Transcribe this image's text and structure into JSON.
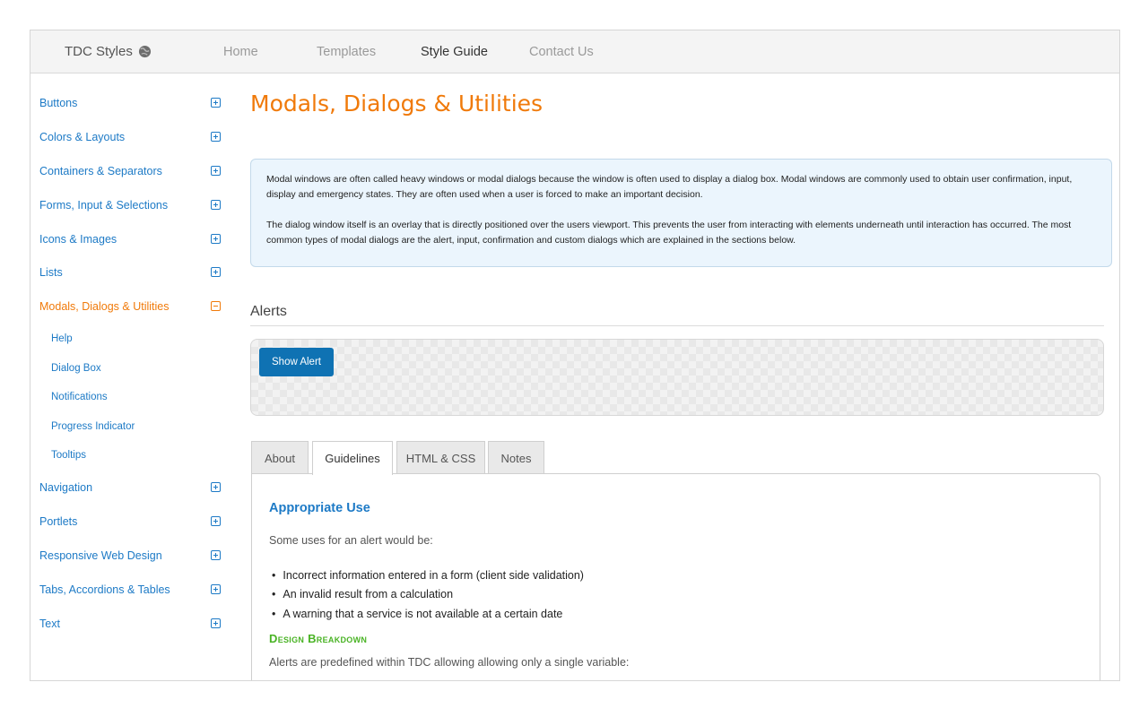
{
  "topnav": {
    "brand": "TDC Styles",
    "items": [
      {
        "label": "Home",
        "active": false
      },
      {
        "label": "Templates",
        "active": false
      },
      {
        "label": "Style Guide",
        "active": true
      },
      {
        "label": "Contact Us",
        "active": false
      }
    ]
  },
  "sidebar": {
    "items": [
      {
        "label": "Buttons"
      },
      {
        "label": "Colors & Layouts"
      },
      {
        "label": "Containers & Separators"
      },
      {
        "label": "Forms, Input & Selections"
      },
      {
        "label": "Icons & Images"
      },
      {
        "label": "Lists"
      },
      {
        "label": "Modals, Dialogs & Utilities"
      },
      {
        "label": "Navigation"
      },
      {
        "label": "Portlets"
      },
      {
        "label": "Responsive Web Design"
      },
      {
        "label": "Tabs, Accordions & Tables"
      },
      {
        "label": "Text"
      }
    ],
    "subitems": [
      "Help",
      "Dialog Box",
      "Notifications",
      "Progress Indicator",
      "Tooltips"
    ]
  },
  "main": {
    "title": "Modals, Dialogs & Utilities",
    "intro": [
      "Modal windows are often called heavy windows or modal dialogs because the window is often used to display a dialog box. Modal windows are commonly used to obtain user confirmation, input, display and emergency states. They are often used when a user is forced to make an important decision.",
      "The dialog window itself is an overlay that is directly positioned over the users viewport. This prevents the user from interacting with elements underneath until interaction has occurred. The most common types of modal dialogs are the alert, input, confirmation and custom dialogs which are explained in the sections below."
    ],
    "section": "Alerts",
    "demo_button": "Show Alert",
    "tabs": [
      "About",
      "Guidelines",
      "HTML & CSS",
      "Notes"
    ],
    "active_tab": "Guidelines",
    "panel": {
      "heading": "Appropriate Use",
      "lead": "Some uses for an alert would be:",
      "bullets": [
        "Incorrect information entered in a form (client side validation)",
        "An invalid result from a calculation",
        "A warning that a service is not available at a certain date"
      ],
      "subheading": "Design Breakdown",
      "trailing": "Alerts are predefined within TDC allowing allowing only a single variable:"
    }
  },
  "colors": {
    "accent_orange": "#f07a0a",
    "link_blue": "#1d7ac6",
    "button_blue": "#0f72b3",
    "subheading_green": "#49b324"
  }
}
